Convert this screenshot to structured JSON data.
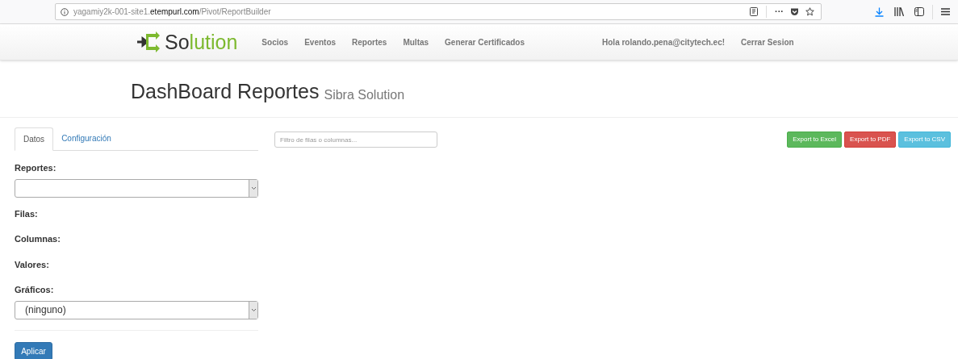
{
  "browser": {
    "url": {
      "prefix": "yagamiy2k-001-site1.",
      "domain": "etempurl.com",
      "path": "/Pivot/ReportBuilder"
    },
    "menu_glyph": "···"
  },
  "navbar": {
    "brand": {
      "dark": "So",
      "accent": "lution"
    },
    "links": [
      "Socios",
      "Eventos",
      "Reportes",
      "Multas",
      "Generar Certificados"
    ],
    "greeting": "Hola rolando.pena@citytech.ec!",
    "logout": "Cerrar Sesion"
  },
  "header": {
    "title": "DashBoard Reportes",
    "subtitle": "Sibra Solution"
  },
  "tabs": [
    {
      "label": "Datos",
      "selected": true
    },
    {
      "label": "Configuración",
      "selected": false
    }
  ],
  "form": {
    "reportes_label": "Reportes:",
    "filas_label": "Filas:",
    "columnas_label": "Columnas:",
    "valores_label": "Valores:",
    "graficos_label": "Gráficos:",
    "graficos_value": "(ninguno)",
    "apply": "Aplicar"
  },
  "filter": {
    "placeholder": "Filtro de filas o columnas..."
  },
  "exports": [
    {
      "label": "Export to Excel",
      "kind": "excel"
    },
    {
      "label": "Export to PDF",
      "kind": "pdf"
    },
    {
      "label": "Export to CSV",
      "kind": "csv"
    }
  ]
}
